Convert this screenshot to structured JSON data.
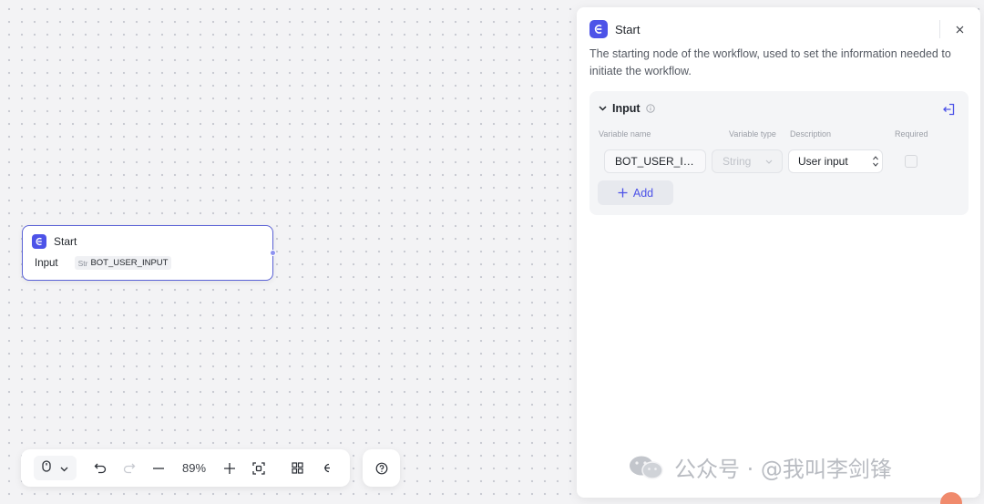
{
  "node": {
    "title": "Start",
    "input_label": "Input",
    "param_type": "Str",
    "param_name": "BOT_USER_INPUT"
  },
  "toolbar": {
    "zoom": "89%",
    "icons": [
      "mouse-icon",
      "chevron-down-icon",
      "undo-icon",
      "redo-icon",
      "zoom-out-icon",
      "zoom-in-icon",
      "fit-view-icon",
      "layout-grid-icon",
      "minimap-icon",
      "help-icon"
    ]
  },
  "panel": {
    "title": "Start",
    "description": "The starting node of the workflow, used to set the information needed to initiate the workflow.",
    "section": {
      "title": "Input",
      "columns": {
        "name": "Variable name",
        "type": "Variable type",
        "description": "Description",
        "required": "Required"
      },
      "row": {
        "name": "BOT_USER_I…",
        "type": "String",
        "description": "User input",
        "required": false
      },
      "add_label": "Add"
    }
  },
  "watermark": {
    "text": "公众号 · @我叫李剑锋"
  },
  "colors": {
    "accent": "#4d53e8",
    "node_border": "#5b62d6"
  }
}
